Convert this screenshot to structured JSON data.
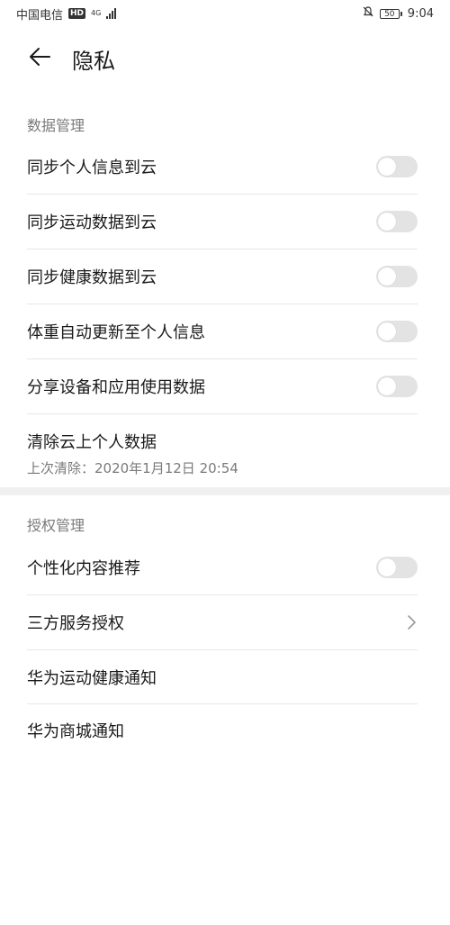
{
  "status_bar": {
    "carrier": "中国电信",
    "hd": "HD",
    "network": "4G",
    "battery": "50",
    "time": "9:04"
  },
  "header": {
    "title": "隐私"
  },
  "sections": {
    "data": {
      "label": "数据管理",
      "items": [
        {
          "label": "同步个人信息到云",
          "toggle": false
        },
        {
          "label": "同步运动数据到云",
          "toggle": false
        },
        {
          "label": "同步健康数据到云",
          "toggle": false
        },
        {
          "label": "体重自动更新至个人信息",
          "toggle": false
        },
        {
          "label": "分享设备和应用使用数据",
          "toggle": false
        }
      ],
      "clear": {
        "label": "清除云上个人数据",
        "subtext": "上次清除：2020年1月12日 20:54"
      }
    },
    "auth": {
      "label": "授权管理",
      "items": [
        {
          "label": "个性化内容推荐"
        },
        {
          "label": "三方服务授权"
        },
        {
          "label": "华为运动健康通知"
        },
        {
          "label": "华为商城通知"
        }
      ]
    }
  },
  "colors": {
    "toggle_off_track": "#e3e3e3",
    "section_text": "#7a7a7a",
    "primary_text": "#1a1a1a"
  }
}
